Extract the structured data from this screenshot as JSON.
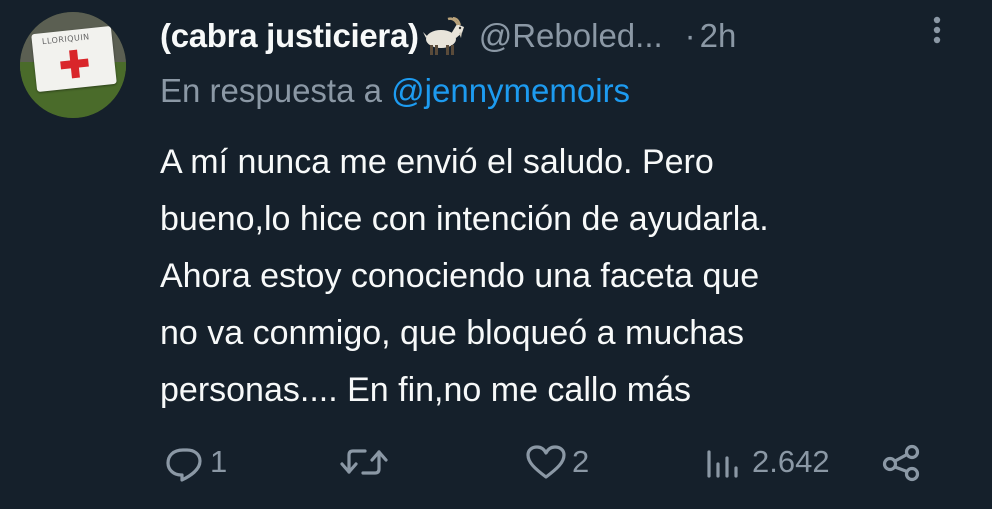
{
  "tweet": {
    "author": {
      "display_name": "(cabra justiciera)",
      "emoji_icon": "goat-icon",
      "handle": "@Reboled...",
      "avatar_sign_text": "LLORIQUIN"
    },
    "time_separator": "·",
    "time": "2h",
    "reply_prefix": "En respuesta a ",
    "reply_mention": "@jennymemoirs",
    "text": "A mí nunca me envió el saludo. Pero\nbueno,lo hice con intención de ayudarla.\nAhora estoy conociendo una faceta que\nno va conmigo, que bloqueó a muchas\npersonas.... En fin,no me callo más",
    "actions": {
      "reply_count": "1",
      "retweet_count": "",
      "like_count": "2",
      "views_count": "2.642"
    },
    "icons": {
      "more": "more-vertical-icon",
      "reply": "reply-icon",
      "retweet": "retweet-icon",
      "like": "heart-icon",
      "views": "views-icon",
      "share": "share-icon"
    },
    "colors": {
      "background": "#15202b",
      "text": "#f7f9f9",
      "secondary": "#8b98a5",
      "link": "#1d9bf0"
    }
  }
}
